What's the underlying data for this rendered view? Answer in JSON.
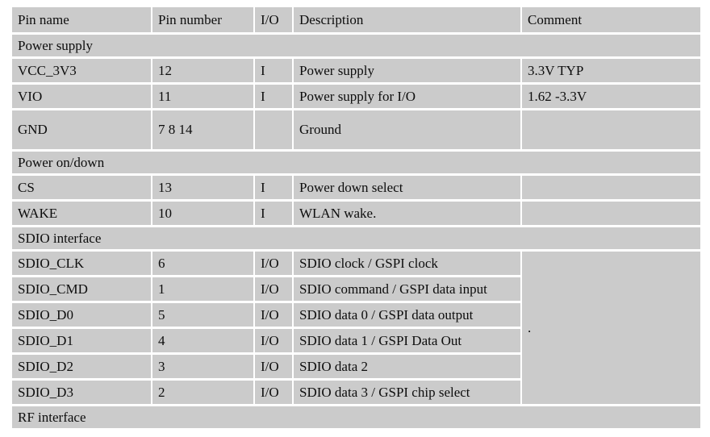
{
  "table": {
    "columns": [
      {
        "key": "pin_name",
        "label": "Pin name"
      },
      {
        "key": "pin_number",
        "label": "Pin number"
      },
      {
        "key": "io",
        "label": "I/O"
      },
      {
        "key": "description",
        "label": "Description"
      },
      {
        "key": "comment",
        "label": "Comment"
      }
    ],
    "sections": [
      {
        "title": "Power supply",
        "rows": [
          {
            "pin_name": "VCC_3V3",
            "pin_number": "12",
            "io": "I",
            "description": "Power supply",
            "comment": "3.3V TYP"
          },
          {
            "pin_name": "VIO",
            "pin_number": "11",
            "io": "I",
            "description": "Power supply for I/O",
            "comment": "1.62 -3.3V"
          },
          {
            "pin_name": "GND",
            "pin_number": "7 8 14",
            "io": "",
            "description": "Ground",
            "comment": ""
          }
        ]
      },
      {
        "title": "Power on/down",
        "rows": [
          {
            "pin_name": "CS",
            "pin_number": "13",
            "io": "I",
            "description": "Power down select",
            "comment": ""
          },
          {
            "pin_name": "WAKE",
            "pin_number": "10",
            "io": "I",
            "description": "WLAN wake.",
            "comment": ""
          }
        ]
      },
      {
        "title": "SDIO interface",
        "merged_comment": ".",
        "rows": [
          {
            "pin_name": "SDIO_CLK",
            "pin_number": "6",
            "io": "I/O",
            "description": "SDIO clock / GSPI clock"
          },
          {
            "pin_name": "SDIO_CMD",
            "pin_number": "1",
            "io": "I/O",
            "description": "SDIO command / GSPI data input"
          },
          {
            "pin_name": "SDIO_D0",
            "pin_number": "5",
            "io": "I/O",
            "description": "SDIO data 0 / GSPI data output"
          },
          {
            "pin_name": "SDIO_D1",
            "pin_number": "4",
            "io": "I/O",
            "description": "SDIO data 1 / GSPI Data Out"
          },
          {
            "pin_name": "SDIO_D2",
            "pin_number": "3",
            "io": "I/O",
            "description": "SDIO data 2"
          },
          {
            "pin_name": "SDIO_D3",
            "pin_number": "2",
            "io": "I/O",
            "description": "SDIO data 3 / GSPI chip select"
          }
        ]
      },
      {
        "title": "RF interface",
        "rows": []
      }
    ]
  },
  "colors": {
    "page_background": "#ffffff",
    "header_row_background": "#8a8a8a",
    "section_row_background": "#9a9a9a",
    "cell_background": "#cbcbcb",
    "text": "#0d0d0d"
  }
}
